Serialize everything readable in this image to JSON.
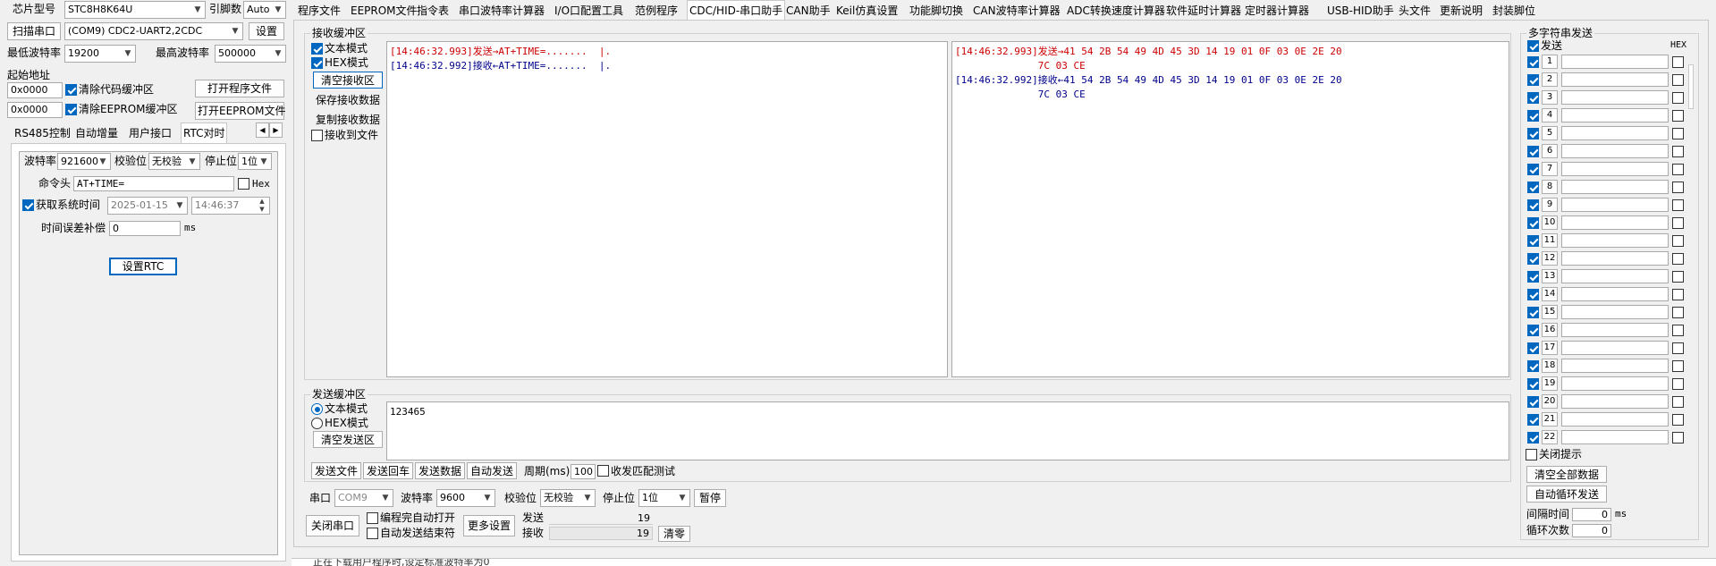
{
  "left": {
    "chip_label": "芯片型号",
    "chip_value": "STC8H8K64U",
    "pins_label": "引脚数",
    "pins_value": "Auto",
    "scan_button": "扫描串口",
    "port_value": "(COM9) CDC2-UART2,2CDC",
    "settings_button": "设置",
    "min_baud_label": "最低波特率",
    "min_baud_value": "19200",
    "max_baud_label": "最高波特率",
    "max_baud_value": "500000",
    "start_addr_label": "起始地址",
    "addr1_value": "0x0000",
    "addr2_value": "0x0000",
    "clear_code_label": "清除代码缓冲区",
    "clear_eeprom_label": "清除EEPROM缓冲区",
    "open_program_button": "打开程序文件",
    "open_eeprom_button": "打开EEPROM文件",
    "tabs": [
      "RS485控制",
      "自动增量",
      "用户接口",
      "RTC对时"
    ],
    "rtc": {
      "baud_label": "波特率",
      "baud_value": "921600",
      "parity_label": "校验位",
      "parity_value": "无校验",
      "stop_label": "停止位",
      "stop_value": "1位",
      "cmd_label": "命令头",
      "cmd_value": "AT+TIME=",
      "hex_label": "Hex",
      "get_time_label": "获取系统时间",
      "date_value": "2025-01-15",
      "time_value": "14:46:37",
      "offset_label": "时间误差补偿",
      "offset_value": "0",
      "offset_unit": "ms",
      "set_rtc_button": "设置RTC"
    }
  },
  "toptabs": [
    "程序文件",
    "EEPROM文件",
    "指令表",
    "串口波特率计算器",
    "I/O口配置工具",
    "范例程序",
    "CDC/HID-串口助手",
    "CAN助手",
    "Keil仿真设置",
    "功能脚切换",
    "CAN波特率计算器",
    "ADC转换速度计算器",
    "软件延时计算器",
    "定时器计算器",
    "USB-HID助手",
    "头文件",
    "更新说明",
    "封装脚位"
  ],
  "recv": {
    "title": "接收缓冲区",
    "text_mode": "文本模式",
    "hex_mode": "HEX模式",
    "clear_button": "清空接收区",
    "save_button": "保存接收数据",
    "copy_button": "复制接收数据",
    "to_file": "接收到文件",
    "text_lines": [
      {
        "text": "[14:46:32.993]发送→AT+TIME=.......  |.",
        "color": "#cc0000"
      },
      {
        "text": "[14:46:32.992]接收←AT+TIME=.......  |.",
        "color": "#00008b"
      }
    ],
    "hex_lines": [
      {
        "text": "[14:46:32.993]发送→41 54 2B 54 49 4D 45 3D 14 19 01 0F 03 0E 2E 20",
        "color": "#cc0000"
      },
      {
        "text": "              7C 03 CE",
        "color": "#cc0000"
      },
      {
        "text": "[14:46:32.992]接收←41 54 2B 54 49 4D 45 3D 14 19 01 0F 03 0E 2E 20",
        "color": "#00008b"
      },
      {
        "text": "              7C 03 CE",
        "color": "#00008b"
      }
    ]
  },
  "send": {
    "title": "发送缓冲区",
    "text_mode": "文本模式",
    "hex_mode": "HEX模式",
    "clear_button": "清空发送区",
    "content": "123465",
    "send_file": "发送文件",
    "send_enter": "发送回车",
    "send_data": "发送数据",
    "auto_send": "自动发送",
    "period_label": "周期(ms)",
    "period_value": "100",
    "match_test": "收发匹配测试"
  },
  "port": {
    "port_label": "串口",
    "port_value": "COM9",
    "baud_label": "波特率",
    "baud_value": "9600",
    "parity_label": "校验位",
    "parity_value": "无校验",
    "stop_label": "停止位",
    "stop_value": "1位",
    "pause_button": "暂停",
    "close_button": "关闭串口",
    "auto_open": "编程完自动打开",
    "auto_send_end": "自动发送结束符",
    "more_button": "更多设置",
    "sent_label": "发送",
    "sent_value": "19",
    "recv_label": "接收",
    "recv_value": "19",
    "clear_button": "清零"
  },
  "multi": {
    "title": "多字符串发送",
    "send_col": "发送",
    "hex_col": "HEX",
    "rows": [
      "1",
      "2",
      "3",
      "4",
      "5",
      "6",
      "7",
      "8",
      "9",
      "10",
      "11",
      "12",
      "13",
      "14",
      "15",
      "16",
      "17",
      "18",
      "19",
      "20",
      "21",
      "22"
    ],
    "close_tip": "关闭提示",
    "clear_all": "清空全部数据",
    "auto_loop": "自动循环发送",
    "interval_label": "间隔时间",
    "interval_value": "0",
    "interval_unit": "ms",
    "loop_label": "循环次数",
    "loop_value": "0"
  },
  "status_text": "正在下载用户程序时,设定标准波特率为0"
}
